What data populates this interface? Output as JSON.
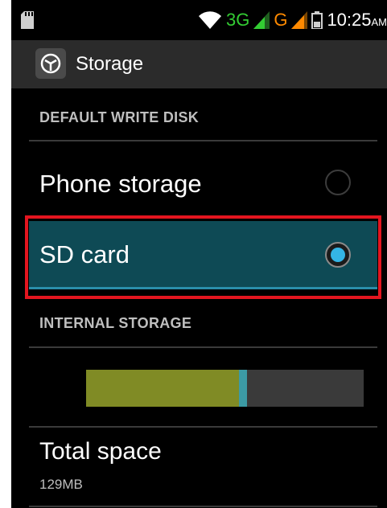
{
  "status_bar": {
    "network_3g": "3G",
    "network_g": "G",
    "time": "10:25",
    "ampm": "AM",
    "icons": [
      "sd-card-icon",
      "wifi-icon",
      "signal-icon",
      "battery-icon"
    ]
  },
  "action_bar": {
    "title": "Storage",
    "icon": "settings-icon"
  },
  "default_write_disk": {
    "header": "DEFAULT WRITE DISK",
    "options": [
      {
        "label": "Phone storage",
        "selected": false
      },
      {
        "label": "SD card",
        "selected": true
      }
    ]
  },
  "internal_storage": {
    "header": "INTERNAL STORAGE",
    "usage": {
      "used_fraction": 0.55,
      "other_fraction": 0.03,
      "used_color": "#808b25",
      "other_color": "#3c9aa4",
      "free_color": "#3a3a3a"
    },
    "total_space_label": "Total space",
    "total_space_value": "129MB"
  },
  "colors": {
    "selected_row_bg": "#0e4a55",
    "radio_checked": "#34b5e5",
    "highlight_border": "#e3151f"
  }
}
